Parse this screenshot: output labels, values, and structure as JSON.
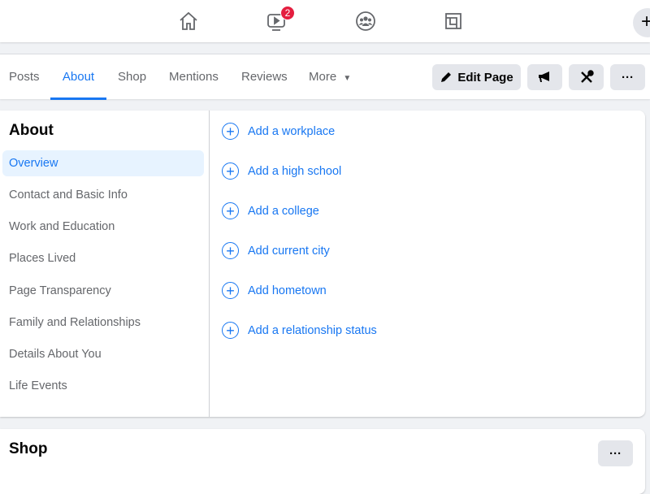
{
  "topnav": {
    "video_badge": "2",
    "plus": "+"
  },
  "tabs": [
    "Posts",
    "About",
    "Shop",
    "Mentions",
    "Reviews",
    "More"
  ],
  "actions": {
    "edit_page": "Edit Page",
    "more": "···"
  },
  "about": {
    "title": "About",
    "items": [
      "Overview",
      "Contact and Basic Info",
      "Work and Education",
      "Places Lived",
      "Page Transparency",
      "Family and Relationships",
      "Details About You",
      "Life Events"
    ],
    "add_items": [
      "Add a workplace",
      "Add a high school",
      "Add a college",
      "Add current city",
      "Add hometown",
      "Add a relationship status"
    ]
  },
  "shop": {
    "title": "Shop",
    "more": "···"
  },
  "colors": {
    "accent": "#1877f2",
    "badge": "#e41e3f"
  }
}
